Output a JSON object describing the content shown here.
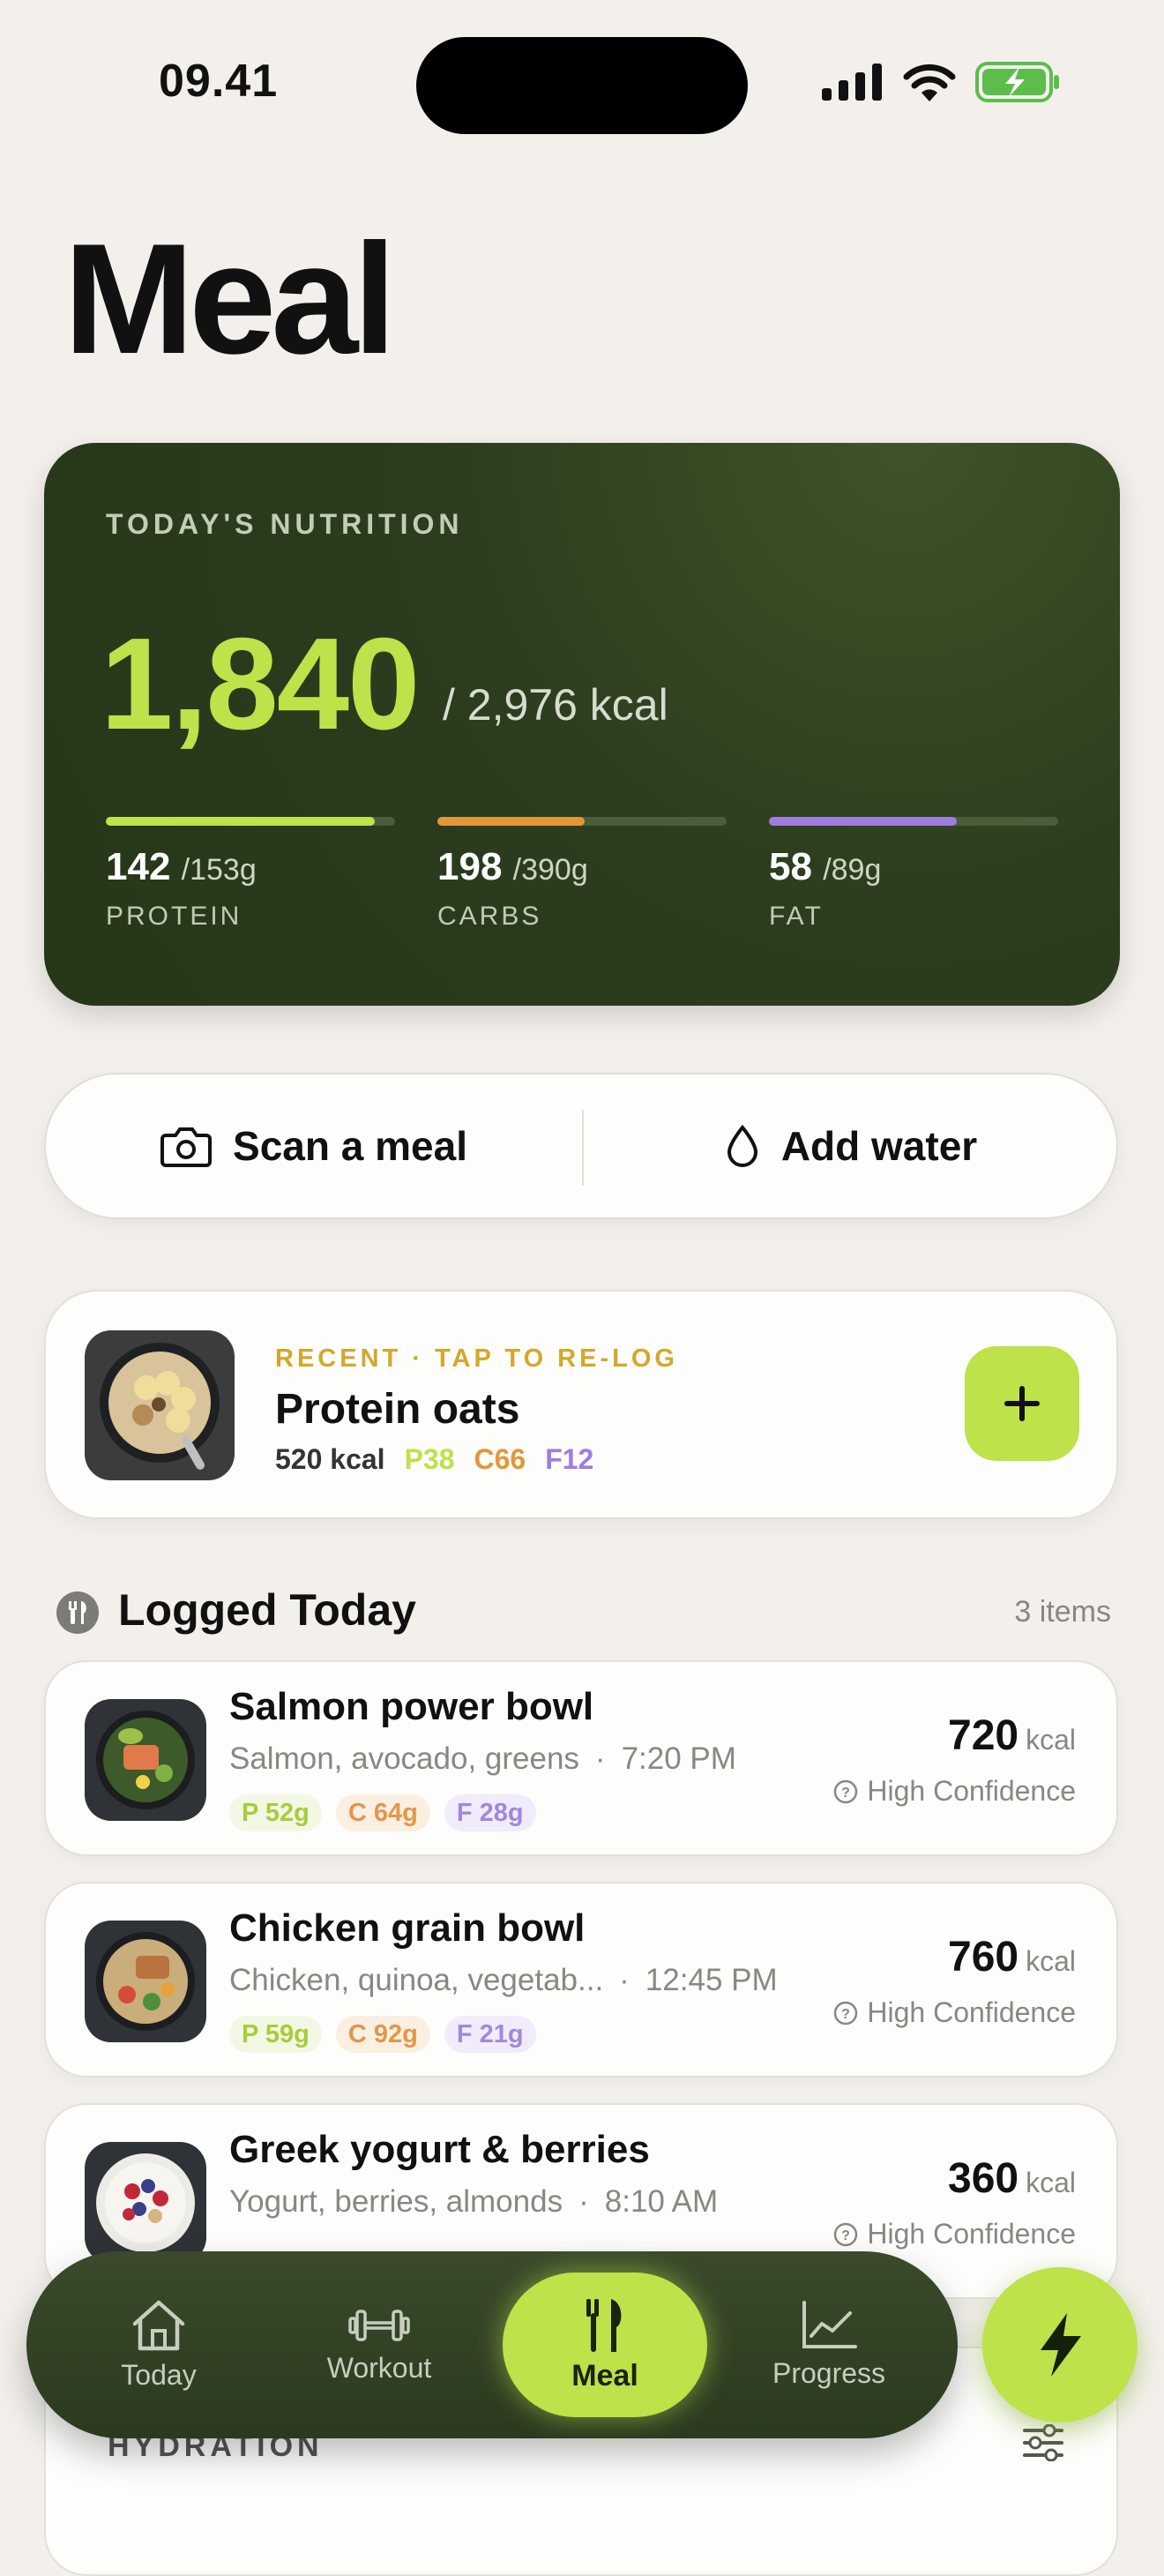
{
  "status": {
    "time": "09.41",
    "icons": [
      "signal-icon",
      "wifi-icon",
      "battery-charging-icon"
    ]
  },
  "page": {
    "title": "Meal"
  },
  "nutrition": {
    "label": "TODAY'S NUTRITION",
    "calories": "1,840",
    "goal": "/ 2,976 kcal",
    "macros": [
      {
        "name": "PROTEIN",
        "value": "142",
        "goal": "/153g",
        "progress": 0.93,
        "color": "#bde24a"
      },
      {
        "name": "CARBS",
        "value": "198",
        "goal": "/390g",
        "progress": 0.51,
        "color": "#e3973a"
      },
      {
        "name": "FAT",
        "value": "58",
        "goal": "/89g",
        "progress": 0.65,
        "color": "#a07ce0"
      }
    ]
  },
  "actions": {
    "scan_label": "Scan a meal",
    "water_label": "Add water"
  },
  "recent": {
    "tag": "RECENT · TAP TO RE-LOG",
    "name": "Protein oats",
    "kcal": "520 kcal",
    "p": "P38",
    "c": "C66",
    "f": "F12"
  },
  "logged": {
    "title": "Logged Today",
    "count": "3 items",
    "items": [
      {
        "name": "Salmon power bowl",
        "desc": "Salmon, avocado, greens",
        "time": "7:20 PM",
        "p": "P 52g",
        "c": "C 64g",
        "f": "F 28g",
        "kcal": "720",
        "unit": "kcal",
        "confidence": "High Confidence"
      },
      {
        "name": "Chicken grain bowl",
        "desc": "Chicken, quinoa, vegetab...",
        "time": "12:45 PM",
        "p": "P 59g",
        "c": "C 92g",
        "f": "F 21g",
        "kcal": "760",
        "unit": "kcal",
        "confidence": "High Confidence"
      },
      {
        "name": "Greek yogurt & berries",
        "desc": "Yogurt, berries, almonds",
        "time": "8:10 AM",
        "p": "",
        "c": "",
        "f": "",
        "kcal": "360",
        "unit": "kcal",
        "confidence": "High Confidence"
      }
    ]
  },
  "hydration": {
    "label": "HYDRATION"
  },
  "tabs": {
    "today": "Today",
    "workout": "Workout",
    "meal": "Meal",
    "progress": "Progress"
  },
  "colors": {
    "accent": "#bde24a",
    "card_dark": "#2c3d1f",
    "carbs": "#e3973a",
    "fat": "#a07ce0",
    "recent_tag": "#d4a72c"
  }
}
